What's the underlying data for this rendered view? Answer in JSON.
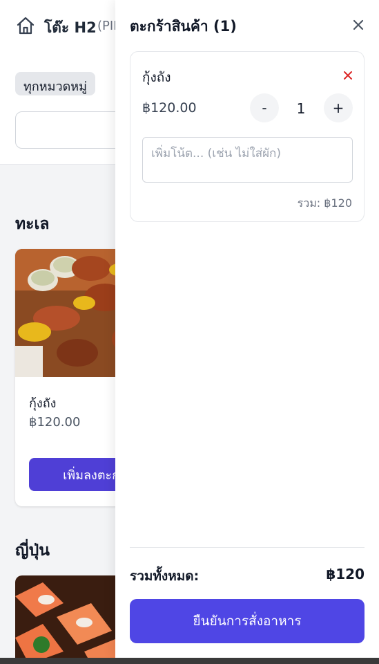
{
  "header": {
    "table_name": "โต๊ะ H2",
    "table_code": "(PIII"
  },
  "filters": {
    "category_selected": "ทุกหมวดหมู่"
  },
  "sections": [
    {
      "title": "ทะเล",
      "products": [
        {
          "name": "กุ้งถัง",
          "price": "฿120.00",
          "add_label": "เพิ่มลงตะกร้า"
        }
      ]
    },
    {
      "title": "ญี่ปุ่น"
    }
  ],
  "cart": {
    "title": "ตะกร้าสินค้า (1)",
    "items": [
      {
        "name": "กุ้งถัง",
        "price": "฿120.00",
        "quantity": "1",
        "minus_label": "-",
        "plus_label": "+",
        "note_placeholder": "เพิ่มโน้ต... (เช่น ไม่ใส่ผัก)",
        "subtotal": "รวม: ฿120"
      }
    ],
    "total_label": "รวมทั้งหมด:",
    "total_value": "฿120",
    "confirm_label": "ยืนยันการสั่งอาหาร"
  },
  "icons": {
    "home": "home-icon",
    "close": "close-icon",
    "remove": "remove-item-icon"
  },
  "colors": {
    "primary": "#4f46e5",
    "remove": "#dc2626",
    "background": "#f3f4f6"
  }
}
